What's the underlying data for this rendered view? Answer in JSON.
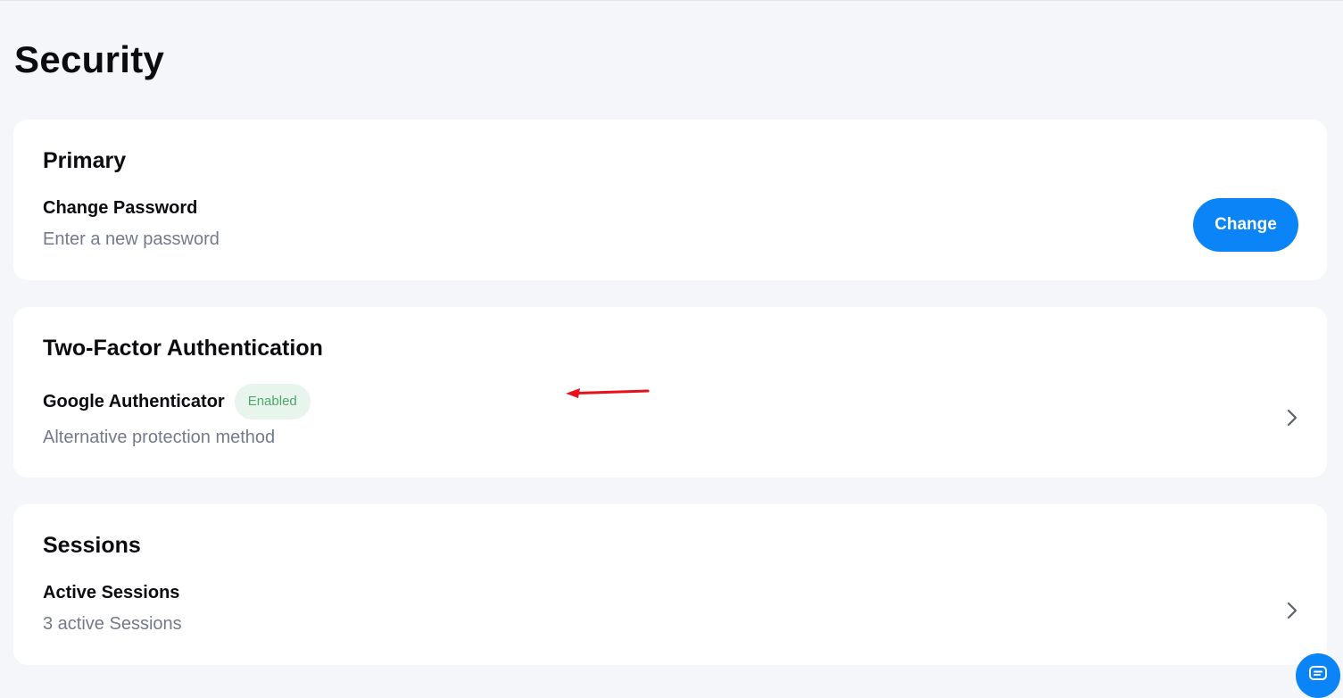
{
  "page": {
    "title": "Security"
  },
  "primary": {
    "title": "Primary",
    "change_password": {
      "label": "Change Password",
      "description": "Enter a new password",
      "button_label": "Change"
    }
  },
  "two_factor": {
    "title": "Two-Factor Authentication",
    "google_authenticator": {
      "label": "Google Authenticator",
      "status": "Enabled",
      "description": "Alternative protection method"
    }
  },
  "sessions": {
    "title": "Sessions",
    "active_sessions": {
      "label": "Active Sessions",
      "description": "3 active Sessions"
    }
  },
  "icons": {
    "row_chevron": "chevron-right-icon",
    "annotation_arrow": "arrow-left-icon",
    "chat": "chat-icon"
  },
  "colors": {
    "accent": "#0a84f7",
    "status_enabled_text": "#4da76a",
    "status_enabled_bg": "#e7f5ec",
    "annotation": "#e8111a",
    "page_background": "#f5f6f9"
  }
}
